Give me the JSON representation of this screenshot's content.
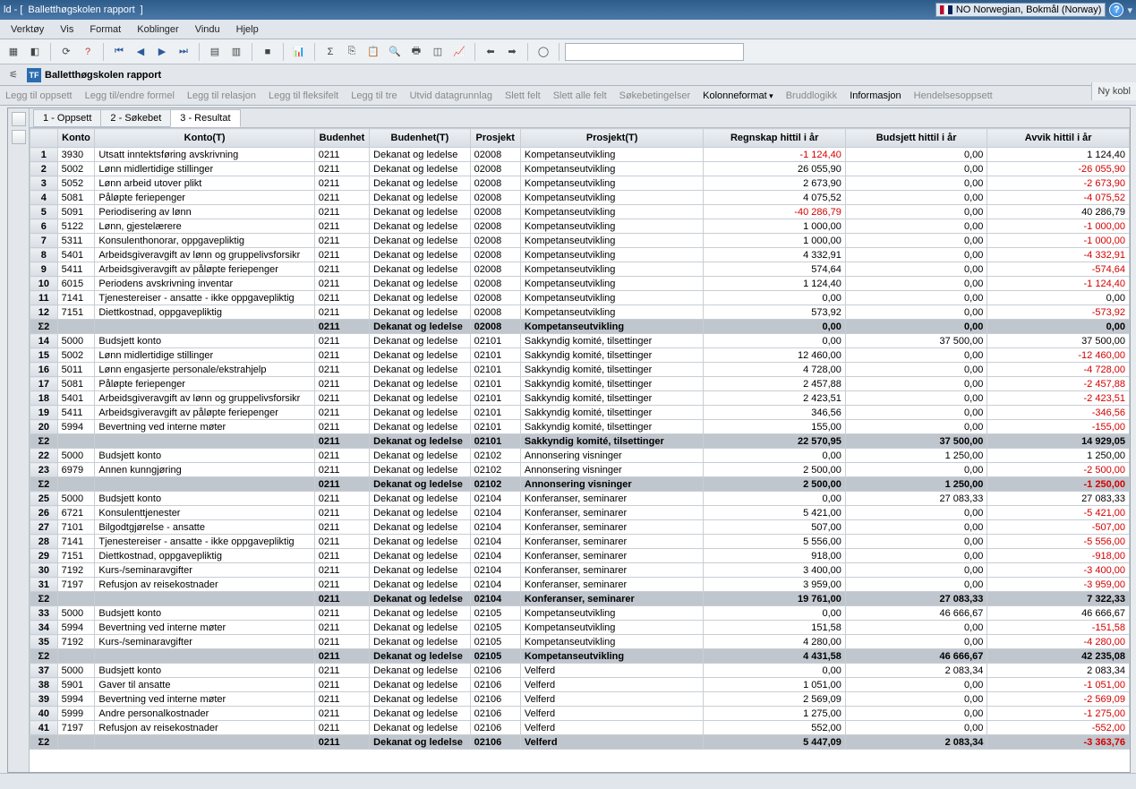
{
  "title_prefix": "ld - [",
  "title_doc": "Balletthøgskolen rapport",
  "title_suffix": "]",
  "language": "NO Norwegian, Bokmål (Norway)",
  "menu": {
    "verktoy": "Verktøy",
    "vis": "Vis",
    "format": "Format",
    "koblinger": "Koblinger",
    "vindu": "Vindu",
    "hjelp": "Hjelp"
  },
  "doc_tab": "Balletthøgskolen rapport",
  "right_btn": "Ny kobl",
  "ribbon": {
    "legg_oppsett": "Legg til oppsett",
    "endre_formel": "Legg til/endre formel",
    "legg_relasjon": "Legg til relasjon",
    "legg_fleksifelt": "Legg til fleksifelt",
    "legg_tre": "Legg til tre",
    "utvid": "Utvid datagrunnlag",
    "slett_felt": "Slett felt",
    "slett_alle": "Slett alle felt",
    "sokebetingelser": "Søkebetingelser",
    "kolonneformat": "Kolonneformat",
    "bruddlogikk": "Bruddlogikk",
    "informasjon": "Informasjon",
    "hendelse": "Hendelsesoppsett"
  },
  "tabs": {
    "t1": "1 - Oppsett",
    "t2": "2 - Søkebet",
    "t3": "3 - Resultat"
  },
  "columns": {
    "rownum": "",
    "konto": "Konto",
    "kontoT": "Konto(T)",
    "budenhet": "Budenhet",
    "budenhetT": "Budenhet(T)",
    "prosjekt": "Prosjekt",
    "prosjektT": "Prosjekt(T)",
    "regnskap": "Regnskap hittil i år",
    "budsjett": "Budsjett hittil i år",
    "avvik": "Avvik hittil i år"
  },
  "sum_label": "Σ2",
  "rows": [
    {
      "n": "1",
      "konto": "3930",
      "kontoT": "Utsatt inntektsføring avskrivning",
      "bud": "0211",
      "budT": "Dekanat og ledelse",
      "pr": "02008",
      "prT": "Kompetanseutvikling",
      "reg": "-1 124,40",
      "buds": "0,00",
      "avv": "1 124,40"
    },
    {
      "n": "2",
      "konto": "5002",
      "kontoT": "Lønn midlertidige stillinger",
      "bud": "0211",
      "budT": "Dekanat og ledelse",
      "pr": "02008",
      "prT": "Kompetanseutvikling",
      "reg": "26 055,90",
      "buds": "0,00",
      "avv": "-26 055,90"
    },
    {
      "n": "3",
      "konto": "5052",
      "kontoT": "Lønn arbeid utover plikt",
      "bud": "0211",
      "budT": "Dekanat og ledelse",
      "pr": "02008",
      "prT": "Kompetanseutvikling",
      "reg": "2 673,90",
      "buds": "0,00",
      "avv": "-2 673,90"
    },
    {
      "n": "4",
      "konto": "5081",
      "kontoT": "Påløpte feriepenger",
      "bud": "0211",
      "budT": "Dekanat og ledelse",
      "pr": "02008",
      "prT": "Kompetanseutvikling",
      "reg": "4 075,52",
      "buds": "0,00",
      "avv": "-4 075,52"
    },
    {
      "n": "5",
      "konto": "5091",
      "kontoT": "Periodisering av lønn",
      "bud": "0211",
      "budT": "Dekanat og ledelse",
      "pr": "02008",
      "prT": "Kompetanseutvikling",
      "reg": "-40 286,79",
      "buds": "0,00",
      "avv": "40 286,79"
    },
    {
      "n": "6",
      "konto": "5122",
      "kontoT": "Lønn, gjestelærere",
      "bud": "0211",
      "budT": "Dekanat og ledelse",
      "pr": "02008",
      "prT": "Kompetanseutvikling",
      "reg": "1 000,00",
      "buds": "0,00",
      "avv": "-1 000,00"
    },
    {
      "n": "7",
      "konto": "5311",
      "kontoT": "Konsulenthonorar, oppgavepliktig",
      "bud": "0211",
      "budT": "Dekanat og ledelse",
      "pr": "02008",
      "prT": "Kompetanseutvikling",
      "reg": "1 000,00",
      "buds": "0,00",
      "avv": "-1 000,00"
    },
    {
      "n": "8",
      "konto": "5401",
      "kontoT": "Arbeidsgiveravgift av lønn og gruppelivsforsikr",
      "bud": "0211",
      "budT": "Dekanat og ledelse",
      "pr": "02008",
      "prT": "Kompetanseutvikling",
      "reg": "4 332,91",
      "buds": "0,00",
      "avv": "-4 332,91"
    },
    {
      "n": "9",
      "konto": "5411",
      "kontoT": "Arbeidsgiveravgift av påløpte feriepenger",
      "bud": "0211",
      "budT": "Dekanat og ledelse",
      "pr": "02008",
      "prT": "Kompetanseutvikling",
      "reg": "574,64",
      "buds": "0,00",
      "avv": "-574,64"
    },
    {
      "n": "10",
      "konto": "6015",
      "kontoT": "Periodens avskrivning inventar",
      "bud": "0211",
      "budT": "Dekanat og ledelse",
      "pr": "02008",
      "prT": "Kompetanseutvikling",
      "reg": "1 124,40",
      "buds": "0,00",
      "avv": "-1 124,40"
    },
    {
      "n": "11",
      "konto": "7141",
      "kontoT": "Tjenestereiser - ansatte - ikke oppgavepliktig",
      "bud": "0211",
      "budT": "Dekanat og ledelse",
      "pr": "02008",
      "prT": "Kompetanseutvikling",
      "reg": "0,00",
      "buds": "0,00",
      "avv": "0,00"
    },
    {
      "n": "12",
      "konto": "7151",
      "kontoT": "Diettkostnad, oppgavepliktig",
      "bud": "0211",
      "budT": "Dekanat og ledelse",
      "pr": "02008",
      "prT": "Kompetanseutvikling",
      "reg": "573,92",
      "buds": "0,00",
      "avv": "-573,92"
    },
    {
      "sum": true,
      "bud": "0211",
      "budT": "Dekanat og ledelse",
      "pr": "02008",
      "prT": "Kompetanseutvikling",
      "reg": "0,00",
      "buds": "0,00",
      "avv": "0,00"
    },
    {
      "n": "14",
      "konto": "5000",
      "kontoT": "Budsjett konto",
      "bud": "0211",
      "budT": "Dekanat og ledelse",
      "pr": "02101",
      "prT": "Sakkyndig komité, tilsettinger",
      "reg": "0,00",
      "buds": "37 500,00",
      "avv": "37 500,00"
    },
    {
      "n": "15",
      "konto": "5002",
      "kontoT": "Lønn midlertidige stillinger",
      "bud": "0211",
      "budT": "Dekanat og ledelse",
      "pr": "02101",
      "prT": "Sakkyndig komité, tilsettinger",
      "reg": "12 460,00",
      "buds": "0,00",
      "avv": "-12 460,00"
    },
    {
      "n": "16",
      "konto": "5011",
      "kontoT": "Lønn engasjerte personale/ekstrahjelp",
      "bud": "0211",
      "budT": "Dekanat og ledelse",
      "pr": "02101",
      "prT": "Sakkyndig komité, tilsettinger",
      "reg": "4 728,00",
      "buds": "0,00",
      "avv": "-4 728,00"
    },
    {
      "n": "17",
      "konto": "5081",
      "kontoT": "Påløpte feriepenger",
      "bud": "0211",
      "budT": "Dekanat og ledelse",
      "pr": "02101",
      "prT": "Sakkyndig komité, tilsettinger",
      "reg": "2 457,88",
      "buds": "0,00",
      "avv": "-2 457,88"
    },
    {
      "n": "18",
      "konto": "5401",
      "kontoT": "Arbeidsgiveravgift av lønn og gruppelivsforsikr",
      "bud": "0211",
      "budT": "Dekanat og ledelse",
      "pr": "02101",
      "prT": "Sakkyndig komité, tilsettinger",
      "reg": "2 423,51",
      "buds": "0,00",
      "avv": "-2 423,51"
    },
    {
      "n": "19",
      "konto": "5411",
      "kontoT": "Arbeidsgiveravgift av påløpte feriepenger",
      "bud": "0211",
      "budT": "Dekanat og ledelse",
      "pr": "02101",
      "prT": "Sakkyndig komité, tilsettinger",
      "reg": "346,56",
      "buds": "0,00",
      "avv": "-346,56"
    },
    {
      "n": "20",
      "konto": "5994",
      "kontoT": "Bevertning ved interne møter",
      "bud": "0211",
      "budT": "Dekanat og ledelse",
      "pr": "02101",
      "prT": "Sakkyndig komité, tilsettinger",
      "reg": "155,00",
      "buds": "0,00",
      "avv": "-155,00"
    },
    {
      "sum": true,
      "bud": "0211",
      "budT": "Dekanat og ledelse",
      "pr": "02101",
      "prT": "Sakkyndig komité, tilsettinger",
      "reg": "22 570,95",
      "buds": "37 500,00",
      "avv": "14 929,05"
    },
    {
      "n": "22",
      "konto": "5000",
      "kontoT": "Budsjett konto",
      "bud": "0211",
      "budT": "Dekanat og ledelse",
      "pr": "02102",
      "prT": "Annonsering visninger",
      "reg": "0,00",
      "buds": "1 250,00",
      "avv": "1 250,00"
    },
    {
      "n": "23",
      "konto": "6979",
      "kontoT": "Annen kunngjøring",
      "bud": "0211",
      "budT": "Dekanat og ledelse",
      "pr": "02102",
      "prT": "Annonsering visninger",
      "reg": "2 500,00",
      "buds": "0,00",
      "avv": "-2 500,00"
    },
    {
      "sum": true,
      "bud": "0211",
      "budT": "Dekanat og ledelse",
      "pr": "02102",
      "prT": "Annonsering visninger",
      "reg": "2 500,00",
      "buds": "1 250,00",
      "avv": "-1 250,00"
    },
    {
      "n": "25",
      "konto": "5000",
      "kontoT": "Budsjett konto",
      "bud": "0211",
      "budT": "Dekanat og ledelse",
      "pr": "02104",
      "prT": "Konferanser, seminarer",
      "reg": "0,00",
      "buds": "27 083,33",
      "avv": "27 083,33"
    },
    {
      "n": "26",
      "konto": "6721",
      "kontoT": "Konsulenttjenester",
      "bud": "0211",
      "budT": "Dekanat og ledelse",
      "pr": "02104",
      "prT": "Konferanser, seminarer",
      "reg": "5 421,00",
      "buds": "0,00",
      "avv": "-5 421,00"
    },
    {
      "n": "27",
      "konto": "7101",
      "kontoT": "Bilgodtgjørelse - ansatte",
      "bud": "0211",
      "budT": "Dekanat og ledelse",
      "pr": "02104",
      "prT": "Konferanser, seminarer",
      "reg": "507,00",
      "buds": "0,00",
      "avv": "-507,00"
    },
    {
      "n": "28",
      "konto": "7141",
      "kontoT": "Tjenestereiser - ansatte - ikke oppgavepliktig",
      "bud": "0211",
      "budT": "Dekanat og ledelse",
      "pr": "02104",
      "prT": "Konferanser, seminarer",
      "reg": "5 556,00",
      "buds": "0,00",
      "avv": "-5 556,00"
    },
    {
      "n": "29",
      "konto": "7151",
      "kontoT": "Diettkostnad, oppgavepliktig",
      "bud": "0211",
      "budT": "Dekanat og ledelse",
      "pr": "02104",
      "prT": "Konferanser, seminarer",
      "reg": "918,00",
      "buds": "0,00",
      "avv": "-918,00"
    },
    {
      "n": "30",
      "konto": "7192",
      "kontoT": "Kurs-/seminaravgifter",
      "bud": "0211",
      "budT": "Dekanat og ledelse",
      "pr": "02104",
      "prT": "Konferanser, seminarer",
      "reg": "3 400,00",
      "buds": "0,00",
      "avv": "-3 400,00"
    },
    {
      "n": "31",
      "konto": "7197",
      "kontoT": "Refusjon av reisekostnader",
      "bud": "0211",
      "budT": "Dekanat og ledelse",
      "pr": "02104",
      "prT": "Konferanser, seminarer",
      "reg": "3 959,00",
      "buds": "0,00",
      "avv": "-3 959,00"
    },
    {
      "sum": true,
      "bud": "0211",
      "budT": "Dekanat og ledelse",
      "pr": "02104",
      "prT": "Konferanser, seminarer",
      "reg": "19 761,00",
      "buds": "27 083,33",
      "avv": "7 322,33"
    },
    {
      "n": "33",
      "konto": "5000",
      "kontoT": "Budsjett konto",
      "bud": "0211",
      "budT": "Dekanat og ledelse",
      "pr": "02105",
      "prT": "Kompetanseutvikling",
      "reg": "0,00",
      "buds": "46 666,67",
      "avv": "46 666,67"
    },
    {
      "n": "34",
      "konto": "5994",
      "kontoT": "Bevertning ved interne møter",
      "bud": "0211",
      "budT": "Dekanat og ledelse",
      "pr": "02105",
      "prT": "Kompetanseutvikling",
      "reg": "151,58",
      "buds": "0,00",
      "avv": "-151,58"
    },
    {
      "n": "35",
      "konto": "7192",
      "kontoT": "Kurs-/seminaravgifter",
      "bud": "0211",
      "budT": "Dekanat og ledelse",
      "pr": "02105",
      "prT": "Kompetanseutvikling",
      "reg": "4 280,00",
      "buds": "0,00",
      "avv": "-4 280,00"
    },
    {
      "sum": true,
      "bud": "0211",
      "budT": "Dekanat og ledelse",
      "pr": "02105",
      "prT": "Kompetanseutvikling",
      "reg": "4 431,58",
      "buds": "46 666,67",
      "avv": "42 235,08"
    },
    {
      "n": "37",
      "konto": "5000",
      "kontoT": "Budsjett konto",
      "bud": "0211",
      "budT": "Dekanat og ledelse",
      "pr": "02106",
      "prT": "Velferd",
      "reg": "0,00",
      "buds": "2 083,34",
      "avv": "2 083,34"
    },
    {
      "n": "38",
      "konto": "5901",
      "kontoT": "Gaver til ansatte",
      "bud": "0211",
      "budT": "Dekanat og ledelse",
      "pr": "02106",
      "prT": "Velferd",
      "reg": "1 051,00",
      "buds": "0,00",
      "avv": "-1 051,00"
    },
    {
      "n": "39",
      "konto": "5994",
      "kontoT": "Bevertning ved interne møter",
      "bud": "0211",
      "budT": "Dekanat og ledelse",
      "pr": "02106",
      "prT": "Velferd",
      "reg": "2 569,09",
      "buds": "0,00",
      "avv": "-2 569,09"
    },
    {
      "n": "40",
      "konto": "5999",
      "kontoT": "Andre personalkostnader",
      "bud": "0211",
      "budT": "Dekanat og ledelse",
      "pr": "02106",
      "prT": "Velferd",
      "reg": "1 275,00",
      "buds": "0,00",
      "avv": "-1 275,00"
    },
    {
      "n": "41",
      "konto": "7197",
      "kontoT": "Refusjon av reisekostnader",
      "bud": "0211",
      "budT": "Dekanat og ledelse",
      "pr": "02106",
      "prT": "Velferd",
      "reg": "552,00",
      "buds": "0,00",
      "avv": "-552,00"
    },
    {
      "sum": true,
      "bud": "0211",
      "budT": "Dekanat og ledelse",
      "pr": "02106",
      "prT": "Velferd",
      "reg": "5 447,09",
      "buds": "2 083,34",
      "avv": "-3 363,76"
    }
  ]
}
